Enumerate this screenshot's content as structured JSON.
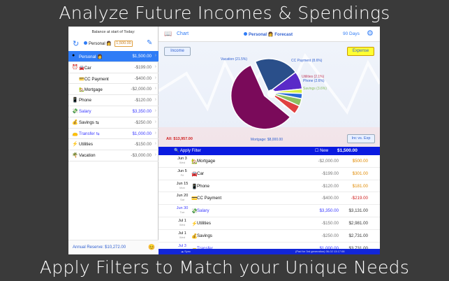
{
  "captions": {
    "top": "Analyze Future Incomes & Spendings",
    "bottom": "Apply Filters to Match your Unique Needs"
  },
  "left": {
    "balance_label": "Balance at start of Today:",
    "account_selector": "Personal 👩",
    "balance_input": "1,500.00",
    "accounts": [
      {
        "icon": "●",
        "name": "Personal 👩",
        "amount": "$1,500.00",
        "selected": true
      },
      {
        "icon": "⏰",
        "name": "🚘Car",
        "amount": "-$199.00"
      },
      {
        "icon": "",
        "name": "💳CC Payment",
        "amount": "-$400.00"
      },
      {
        "icon": "",
        "name": "🏡Mortgage",
        "amount": "-$2,000.00"
      },
      {
        "icon": "📱",
        "name": "Phone",
        "amount": "-$120.00"
      },
      {
        "icon": "💸",
        "name": "Salary",
        "amount": "$3,350.00",
        "blue": true
      },
      {
        "icon": "💰",
        "name": "Savings ⇆",
        "amount": "-$250.00"
      },
      {
        "icon": "👝",
        "name": "Transfer ⇆",
        "amount": "$1,000.00",
        "blue": true
      },
      {
        "icon": "⚡",
        "name": "Utilities",
        "amount": "-$150.00"
      },
      {
        "icon": "🌴",
        "name": "Vacation",
        "amount": "-$3,000.00"
      }
    ],
    "reserve": "Annual Reserve: $10,272.00",
    "reserve_emoji": "😊"
  },
  "topbar": {
    "chart_label": "Chart",
    "title": "Personal 👩 Forecast",
    "days_label": "90 Days"
  },
  "chart": {
    "income_label": "Income",
    "expense_label": "Expense",
    "incexp_label": "Inc vs. Exp",
    "all_label": "All: $13,957.00",
    "colors": {
      "Mortgage": "#7a0a5a",
      "Vacation": "#2a4f8a",
      "CC Payment": "#5a2ac8",
      "Utilities": "#d8f040",
      "Phone": "#2a6ad8",
      "Savings": "#8cc060",
      "Car": "#e04040"
    }
  },
  "chart_data": {
    "type": "pie",
    "slices": [
      {
        "name": "Mortgage",
        "label": "Mortgage: $8,000.00",
        "value": 8000
      },
      {
        "name": "Vacation",
        "label": "Vacation (21.5%)",
        "value": 3000
      },
      {
        "name": "CC Payment",
        "label": "CC Payment (8.6%)",
        "value": 1200
      },
      {
        "name": "Utilities",
        "label": "Utilities (2.1%)",
        "value": 300
      },
      {
        "name": "Phone",
        "label": "Phone (2.6%)",
        "value": 360
      },
      {
        "name": "Savings",
        "label": "Savings (3.6%)",
        "value": 500
      },
      {
        "name": "Car",
        "label": "",
        "value": 597
      }
    ],
    "total": "All: $13,957.00"
  },
  "filterbar": {
    "filter_label": "Apply Filter",
    "new_label": "New",
    "balance": "$1,500.00"
  },
  "transactions": [
    {
      "date": "Jun 3",
      "dow": "Wed",
      "icon": "🏡",
      "name": "Mortgage",
      "amount": "-$2,000.00",
      "running": "$500.00",
      "run_color": "orange"
    },
    {
      "date": "Jun 5",
      "dow": "Fri",
      "icon": "🚘",
      "name": "Car",
      "amount": "-$199.00",
      "running": "$301.00",
      "run_color": "orange"
    },
    {
      "date": "Jun 15",
      "dow": "Mon",
      "icon": "📱",
      "name": "Phone",
      "amount": "-$120.00",
      "running": "$181.00",
      "run_color": "orange"
    },
    {
      "date": "Jun 20",
      "dow": "Sat",
      "icon": "💳",
      "name": "CC Payment",
      "amount": "-$400.00",
      "running": "-$219.00",
      "run_color": "red"
    },
    {
      "date": "Jun 30",
      "dow": "Tue",
      "icon": "💸",
      "name": "Salary",
      "amount": "$3,350.00",
      "running": "$3,131.00",
      "run_color": "gray",
      "blue": true
    },
    {
      "date": "Jul 1",
      "dow": "Wed",
      "icon": "⚡",
      "name": "Utilities",
      "amount": "-$150.00",
      "running": "$2,981.00",
      "run_color": "gray"
    },
    {
      "date": "Jul 1",
      "dow": "Wed",
      "icon": "💰",
      "name": "Savings",
      "amount": "-$250.00",
      "running": "$2,731.00",
      "run_color": "gray"
    },
    {
      "date": "Jul 3",
      "dow": "Fri",
      "icon": "👝",
      "name": "Transfer",
      "amount": "$1,000.00",
      "running": "$3,731.00",
      "run_color": "gray",
      "blue": true
    }
  ],
  "status": {
    "left": "☁ Sync",
    "right": "(Pad for 3rd generation) 06-02 13:17:08"
  }
}
